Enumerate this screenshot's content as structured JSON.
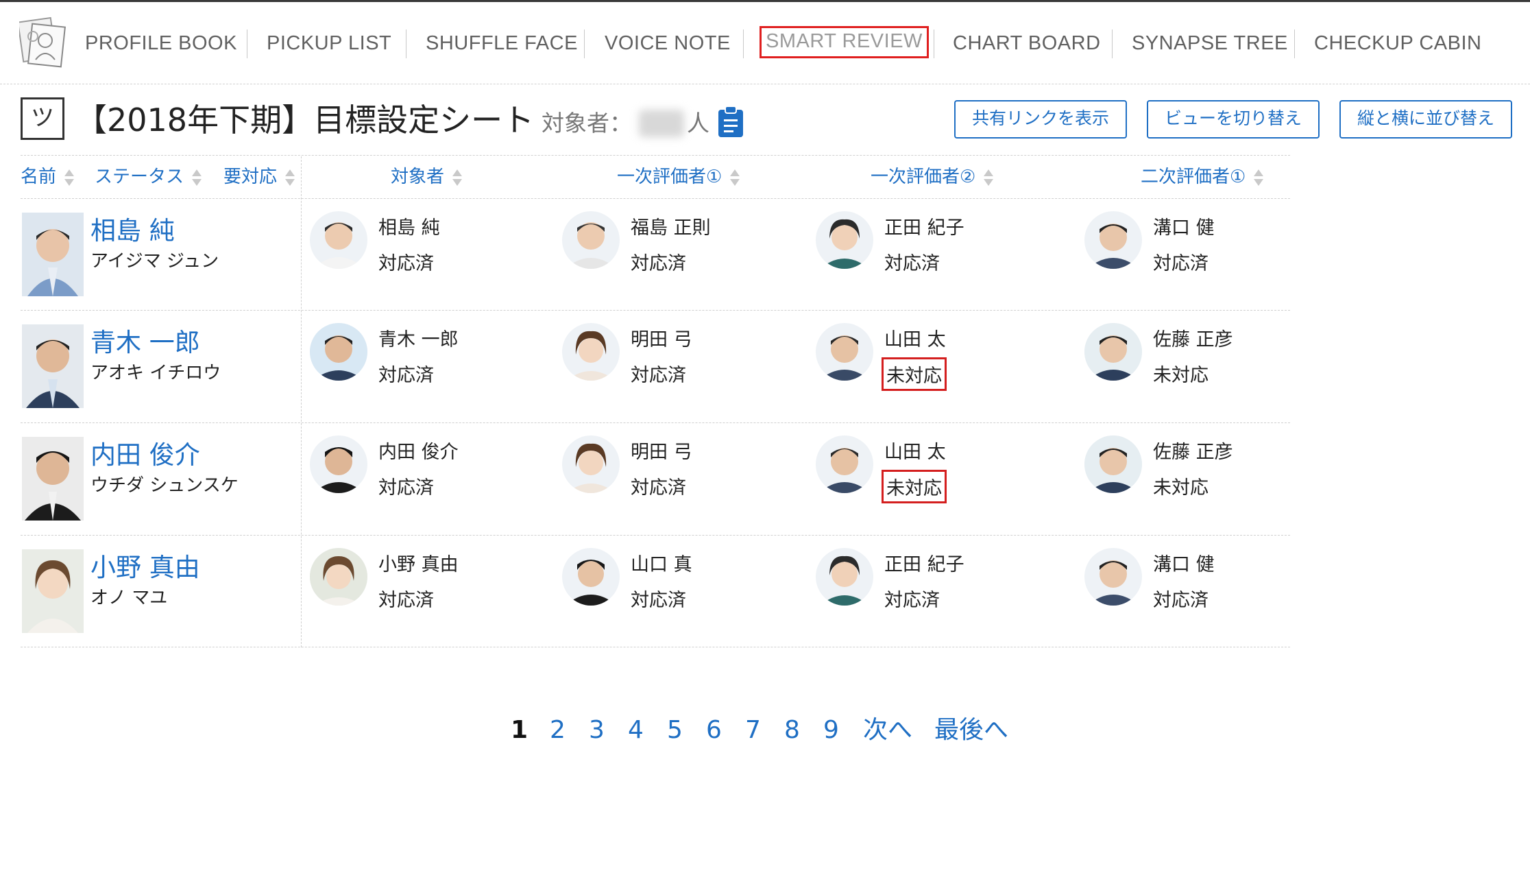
{
  "nav": {
    "items": [
      "PROFILE BOOK",
      "PICKUP LIST",
      "SHUFFLE FACE",
      "VOICE NOTE",
      "SMART REVIEW",
      "CHART BOARD",
      "SYNAPSE TREE",
      "CHECKUP CABIN"
    ],
    "active": "SMART REVIEW"
  },
  "header": {
    "icon_glyph": "ツ",
    "title": "【2018年下期】目標設定シート",
    "target_label": "対象者：",
    "target_unit": "人",
    "buttons": [
      "共有リンクを表示",
      "ビューを切り替え",
      "縦と横に並び替え"
    ]
  },
  "table": {
    "headers": [
      "名前",
      "ステータス",
      "要対応",
      "対象者",
      "一次評価者①",
      "一次評価者②",
      "二次評価者①"
    ],
    "rows": [
      {
        "name": "相島 純",
        "kana": "アイジマ ジュン",
        "cells": [
          {
            "name": "相島 純",
            "status": "対応済",
            "alert": false
          },
          {
            "name": "福島 正則",
            "status": "対応済",
            "alert": false
          },
          {
            "name": "正田 紀子",
            "status": "対応済",
            "alert": false
          },
          {
            "name": "溝口 健",
            "status": "対応済",
            "alert": false
          }
        ]
      },
      {
        "name": "青木 一郎",
        "kana": "アオキ イチロウ",
        "cells": [
          {
            "name": "青木 一郎",
            "status": "対応済",
            "alert": false
          },
          {
            "name": "明田 弓",
            "status": "対応済",
            "alert": false
          },
          {
            "name": "山田 太",
            "status": "未対応",
            "alert": true
          },
          {
            "name": "佐藤 正彦",
            "status": "未対応",
            "alert": false
          }
        ]
      },
      {
        "name": "内田 俊介",
        "kana": "ウチダ シュンスケ",
        "cells": [
          {
            "name": "内田 俊介",
            "status": "対応済",
            "alert": false
          },
          {
            "name": "明田 弓",
            "status": "対応済",
            "alert": false
          },
          {
            "name": "山田 太",
            "status": "未対応",
            "alert": true
          },
          {
            "name": "佐藤 正彦",
            "status": "未対応",
            "alert": false
          }
        ]
      },
      {
        "name": "小野 真由",
        "kana": "オノ マユ",
        "cells": [
          {
            "name": "小野 真由",
            "status": "対応済",
            "alert": false
          },
          {
            "name": "山口 真",
            "status": "対応済",
            "alert": false
          },
          {
            "name": "正田 紀子",
            "status": "対応済",
            "alert": false
          },
          {
            "name": "溝口 健",
            "status": "対応済",
            "alert": false
          }
        ]
      }
    ]
  },
  "pagination": {
    "current": "1",
    "pages": [
      "2",
      "3",
      "4",
      "5",
      "6",
      "7",
      "8",
      "9"
    ],
    "next": "次へ",
    "last": "最後へ"
  },
  "colors": {
    "link": "#1f6fc4",
    "highlight_border": "#e01f1f",
    "nav_text": "#606060"
  }
}
